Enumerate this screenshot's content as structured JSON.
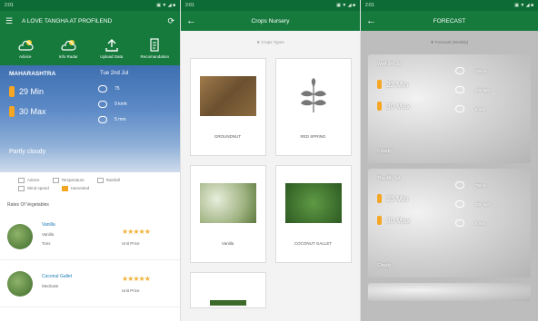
{
  "screen1": {
    "status_time": "2:01",
    "status_icons": "▣ ▼ ◢ ■",
    "app_title": "A LOVE TANGHA AT PROFILEND",
    "refresh_icon": "refresh-icon",
    "menu_icon": "menu-icon",
    "actions": [
      {
        "label": "Advice",
        "icon": "cloud-sun-icon"
      },
      {
        "label": "Info Radar",
        "icon": "cloud-sun-icon"
      },
      {
        "label": "Upload Data",
        "icon": "upload-icon"
      },
      {
        "label": "Recomandation",
        "icon": "document-icon"
      }
    ],
    "weather": {
      "location": "MAHARASHTRA",
      "date": "Tue 2nd Jul",
      "min_temp": "29 Min",
      "max_temp": "30 Max",
      "condition": "Partly cloudy",
      "humidity": "75",
      "wind": "9 kmh",
      "rain": "5 mm"
    },
    "legend": [
      {
        "label": "Advice",
        "alt": false
      },
      {
        "label": "Temperature",
        "alt": false
      },
      {
        "label": "Rainfall",
        "alt": false
      },
      {
        "label": "Wind speed",
        "alt": false
      },
      {
        "label": "Harvested",
        "alt": true
      }
    ],
    "section_title": "Rates Of Vegetables",
    "crops": [
      {
        "name": "Vanilla",
        "line1": "Vanilla",
        "line2": "Tons",
        "rate": "Unit Price",
        "rating": "★★★★★"
      },
      {
        "name": "Coconut Gallet",
        "line1": "Medicate",
        "line2": "",
        "rate": "Unit Price",
        "rating": "★★★★★"
      }
    ]
  },
  "screen2": {
    "status_time": "2:01",
    "status_icons": "▣ ▼ ◢ ■",
    "title": "Crops Nursery",
    "subtitle": "Crops Types",
    "crops": [
      {
        "label": "GROUNDNUT",
        "color": "#8b6b3e"
      },
      {
        "label": "RED SPRING",
        "color": "#ffffff"
      },
      {
        "label": "Vanilla",
        "color": "#b9c7a0"
      },
      {
        "label": "COCONUT GALLET",
        "color": "#3f7a2f"
      }
    ]
  },
  "screen3": {
    "status_time": "2:01",
    "status_icons": "▣ ▼ ◢ ■",
    "title": "FORECAST",
    "subtitle": "Forecast (Weekly)",
    "forecast": [
      {
        "date": "Wed 3rd Jul",
        "min": "23 Min",
        "max": "30 Max",
        "condition": "Cloudy",
        "humidity": "75mm",
        "wind": "100 kph",
        "rain": "5 mm"
      },
      {
        "date": "Thu 4th Jul",
        "min": "23 Min",
        "max": "30 Max",
        "condition": "Cloudy",
        "humidity": "75mm",
        "wind": "100 kph",
        "rain": "5 mm"
      }
    ]
  }
}
